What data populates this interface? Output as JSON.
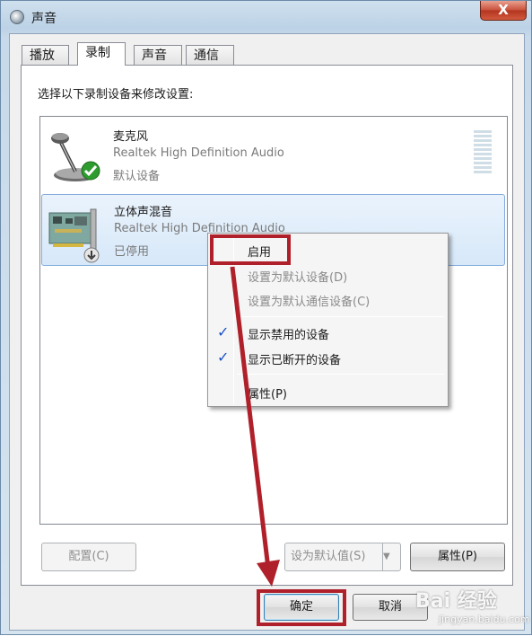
{
  "window": {
    "title": "声音",
    "close_label": "X"
  },
  "tabs": [
    {
      "label": "播放",
      "active": false
    },
    {
      "label": "录制",
      "active": true
    },
    {
      "label": "声音",
      "active": false
    },
    {
      "label": "通信",
      "active": false
    }
  ],
  "instruction": "选择以下录制设备来修改设置:",
  "devices": [
    {
      "name": "麦克风",
      "driver": "Realtek High Definition Audio",
      "status": "默认设备",
      "icon": "microphone-icon",
      "badge": "green-check"
    },
    {
      "name": "立体声混音",
      "driver": "Realtek High Definition Audio",
      "status": "已停用",
      "icon": "sound-card-icon",
      "badge": "disabled-arrow",
      "selected": true
    }
  ],
  "context_menu": {
    "items": [
      {
        "label": "启用",
        "enabled": true,
        "checked": false
      },
      {
        "label": "设置为默认设备(D)",
        "enabled": false,
        "checked": false
      },
      {
        "label": "设置为默认通信设备(C)",
        "enabled": false,
        "checked": false
      },
      {
        "label": "显示禁用的设备",
        "enabled": true,
        "checked": true
      },
      {
        "label": "显示已断开的设备",
        "enabled": true,
        "checked": true
      },
      {
        "label": "属性(P)",
        "enabled": true,
        "checked": false
      }
    ],
    "check_glyph": "✓"
  },
  "buttons": {
    "configure": "配置(C)",
    "set_default": "设为默认值(S)",
    "properties": "属性(P)",
    "ok": "确定",
    "cancel": "取消"
  },
  "watermark": {
    "brand": "Bai 经验",
    "url": "jingyan.baidu.com"
  },
  "colors": {
    "highlight": "#b0202a",
    "selection": "#d7e8f9",
    "check": "#1b52c5"
  }
}
